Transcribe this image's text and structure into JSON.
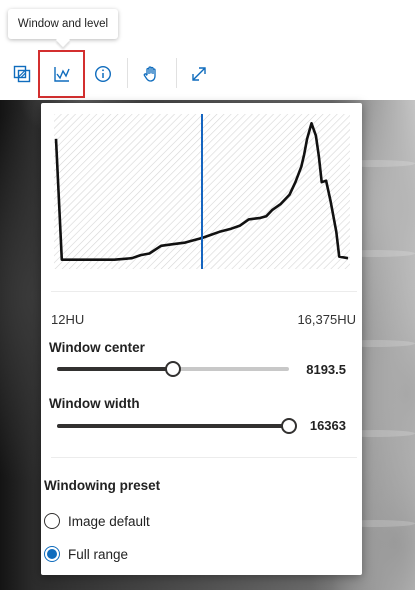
{
  "tooltip": {
    "text": "Window and level"
  },
  "toolbar": {
    "tools": [
      {
        "name": "layers-icon",
        "active": false
      },
      {
        "name": "window-level-icon",
        "active": true
      },
      {
        "name": "info-icon",
        "active": false
      },
      {
        "name": "hand-pan-icon",
        "active": false
      },
      {
        "name": "expand-icon",
        "active": false
      }
    ]
  },
  "panel": {
    "histogram": {
      "marker_fraction": 0.5,
      "curve": [
        [
          0,
          0.16
        ],
        [
          0.02,
          0.94
        ],
        [
          0.06,
          0.94
        ],
        [
          0.12,
          0.94
        ],
        [
          0.2,
          0.94
        ],
        [
          0.26,
          0.93
        ],
        [
          0.29,
          0.91
        ],
        [
          0.32,
          0.9
        ],
        [
          0.36,
          0.85
        ],
        [
          0.4,
          0.84
        ],
        [
          0.44,
          0.83
        ],
        [
          0.46,
          0.82
        ],
        [
          0.5,
          0.8
        ],
        [
          0.53,
          0.78
        ],
        [
          0.56,
          0.76
        ],
        [
          0.6,
          0.74
        ],
        [
          0.63,
          0.72
        ],
        [
          0.66,
          0.68
        ],
        [
          0.7,
          0.67
        ],
        [
          0.72,
          0.66
        ],
        [
          0.74,
          0.62
        ],
        [
          0.77,
          0.58
        ],
        [
          0.8,
          0.52
        ],
        [
          0.82,
          0.44
        ],
        [
          0.84,
          0.34
        ],
        [
          0.85,
          0.26
        ],
        [
          0.86,
          0.16
        ],
        [
          0.875,
          0.06
        ],
        [
          0.89,
          0.14
        ],
        [
          0.9,
          0.27
        ],
        [
          0.91,
          0.44
        ],
        [
          0.925,
          0.43
        ],
        [
          0.94,
          0.56
        ],
        [
          0.96,
          0.76
        ],
        [
          0.97,
          0.92
        ],
        [
          1.0,
          0.93
        ]
      ],
      "colors": {
        "curve": "#111111",
        "marker": "#1565c0",
        "hatch": "#d5d5d5"
      }
    },
    "range": {
      "min": "12HU",
      "max": "16,375HU"
    },
    "window_center": {
      "label": "Window center",
      "value": "8193.5",
      "fraction": 0.5
    },
    "window_width": {
      "label": "Window width",
      "value": "16363",
      "fraction": 1.0
    },
    "preset": {
      "label": "Windowing preset",
      "options": [
        {
          "label": "Image default",
          "checked": false
        },
        {
          "label": "Full range",
          "checked": true
        }
      ]
    }
  }
}
